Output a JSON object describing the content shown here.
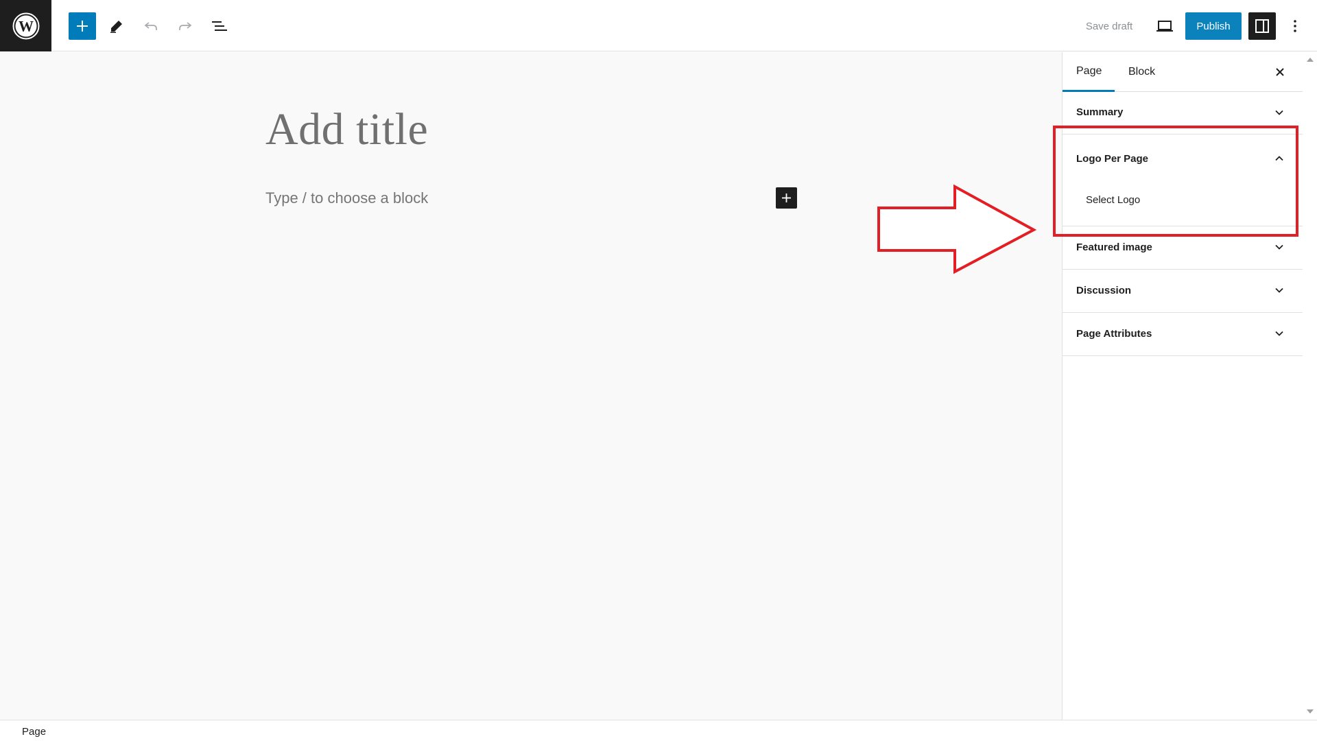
{
  "toolbar": {
    "save_draft_label": "Save draft",
    "publish_label": "Publish"
  },
  "editor": {
    "title_placeholder": "Add title",
    "block_placeholder": "Type / to choose a block"
  },
  "sidebar": {
    "tabs": [
      {
        "label": "Page",
        "active": true
      },
      {
        "label": "Block",
        "active": false
      }
    ],
    "panels": [
      {
        "title": "Summary",
        "expanded": false
      },
      {
        "title": "Logo Per Page",
        "expanded": true,
        "content": "Select Logo"
      },
      {
        "title": "Featured image",
        "expanded": false
      },
      {
        "title": "Discussion",
        "expanded": false
      },
      {
        "title": "Page Attributes",
        "expanded": false
      }
    ]
  },
  "footer": {
    "breadcrumb": "Page"
  },
  "colors": {
    "accent": "#007cba",
    "dark": "#1e1e1e",
    "annotation": "#e31e24"
  }
}
